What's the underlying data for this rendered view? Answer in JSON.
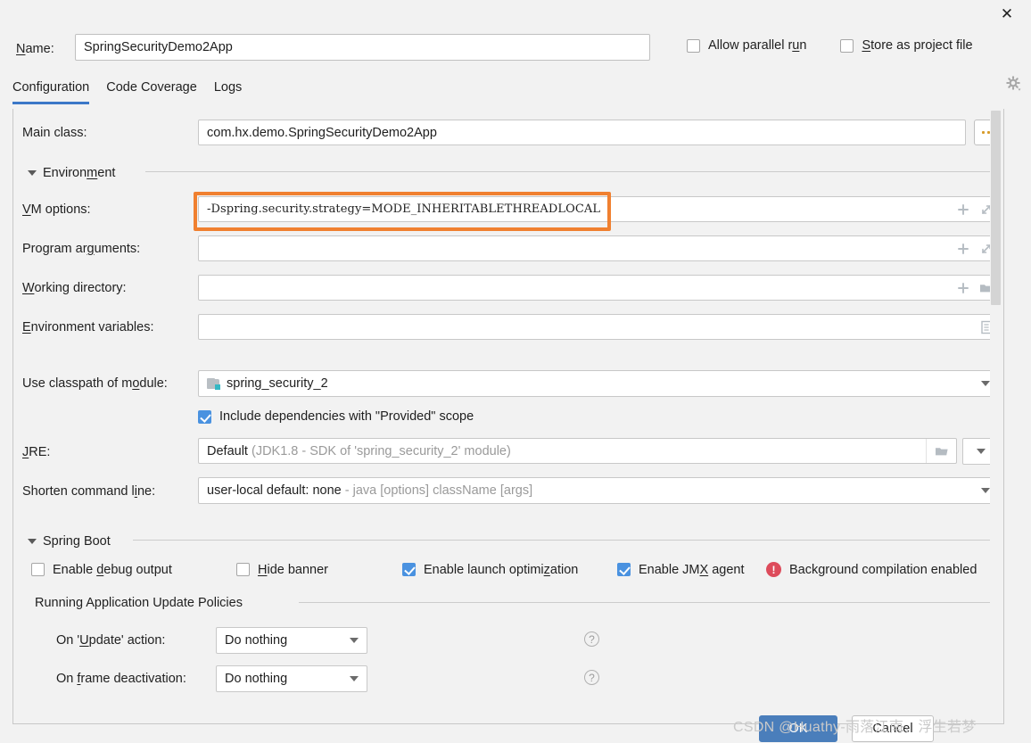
{
  "window": {
    "close_icon": "close-icon"
  },
  "name_row": {
    "label": "Name:",
    "label_mnemonic": "N",
    "value": "SpringSecurityDemo2App",
    "allow_parallel_run": {
      "label": "Allow parallel run",
      "checked": false,
      "mnemonic": "u"
    },
    "store_as_project_file": {
      "label": "Store as project file",
      "checked": false,
      "mnemonic": "S"
    },
    "gear_icon": "gear-dropdown-icon"
  },
  "tabs": [
    {
      "label": "Configuration",
      "active": true
    },
    {
      "label": "Code Coverage",
      "active": false
    },
    {
      "label": "Logs",
      "active": false
    }
  ],
  "main_class": {
    "label": "Main class:",
    "value": "com.hx.demo.SpringSecurityDemo2App",
    "browse_label": "..."
  },
  "environment_section": {
    "title": "Environment",
    "mnemonic": "m",
    "expanded": true
  },
  "vm_options": {
    "label": "VM options:",
    "label_mnemonic": "V",
    "value": "-Dspring.security.strategy=MODE_INHERITABLETHREADLOCAL",
    "highlight_color": "#f08030",
    "add_icon": "plus-icon",
    "expand_icon": "expand-arrows-icon"
  },
  "program_arguments": {
    "label": "Program arguments:",
    "label_mnemonic": "g",
    "value": "",
    "add_icon": "plus-icon",
    "expand_icon": "expand-arrows-icon"
  },
  "working_directory": {
    "label": "Working directory:",
    "label_mnemonic": "W",
    "value": "",
    "add_icon": "plus-icon",
    "folder_icon": "folder-icon"
  },
  "environment_variables": {
    "label": "Environment variables:",
    "label_mnemonic": "E",
    "value": "",
    "list_icon": "list-document-icon"
  },
  "use_classpath_of_module": {
    "label": "Use classpath of module:",
    "label_mnemonic": "o",
    "value": "spring_security_2",
    "module_icon": "module-folder-icon"
  },
  "include_provided": {
    "label": "Include dependencies with \"Provided\" scope",
    "checked": true
  },
  "jre": {
    "label": "JRE:",
    "label_mnemonic": "J",
    "value": "Default",
    "value_hint": "(JDK1.8 - SDK of 'spring_security_2' module)",
    "folder_icon": "folder-icon",
    "dropdown_icon": "chevron-down-icon"
  },
  "shorten_command_line": {
    "label": "Shorten command line:",
    "label_mnemonic": "i",
    "value": "user-local default: none",
    "value_hint": "- java [options] className [args]",
    "dropdown_icon": "chevron-down-icon"
  },
  "spring_boot_section": {
    "title": "Spring Boot",
    "expanded": true,
    "options": [
      {
        "label": "Enable debug output",
        "checked": false,
        "mnemonic": "d",
        "name": "enable-debug-output"
      },
      {
        "label": "Hide banner",
        "checked": false,
        "mnemonic": "H",
        "name": "hide-banner"
      },
      {
        "label": "Enable launch optimization",
        "checked": true,
        "mnemonic": "z",
        "name": "enable-launch-optimization"
      },
      {
        "label": "Enable JMX agent",
        "checked": true,
        "mnemonic": "X",
        "name": "enable-jmx-agent"
      }
    ],
    "background_compilation": {
      "label": "Background compilation enabled",
      "icon": "error-circle-icon",
      "icon_color": "#dd4b5b",
      "icon_glyph": "!"
    }
  },
  "update_policies": {
    "title": "Running Application Update Policies",
    "on_update_action": {
      "label": "On 'Update' action:",
      "label_mnemonic": "U",
      "value": "Do nothing",
      "help_icon": "question-mark-icon",
      "dropdown_icon": "chevron-down-icon"
    },
    "on_frame_deactivation": {
      "label": "On frame deactivation:",
      "label_mnemonic": "f",
      "value": "Do nothing",
      "help_icon": "question-mark-icon",
      "dropdown_icon": "chevron-down-icon"
    }
  },
  "buttons": {
    "ok": "OK",
    "cancel": "Cancel"
  },
  "watermark": "CSDN @Huathy-雨落江南，浮生若梦"
}
